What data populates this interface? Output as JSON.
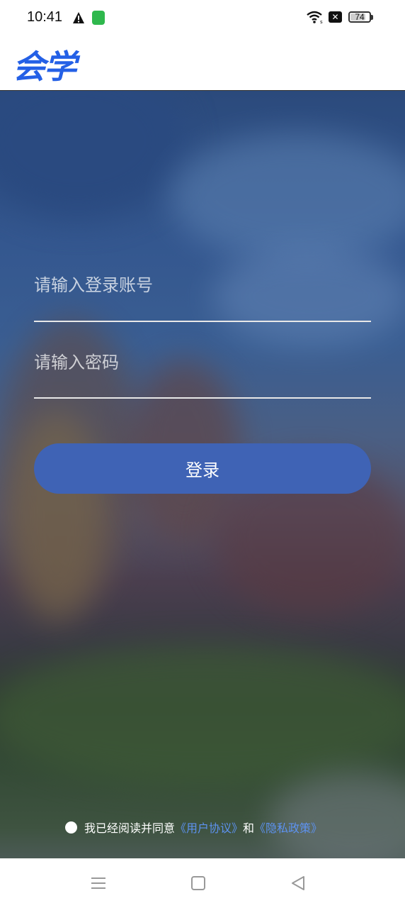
{
  "status_bar": {
    "time": "10:41",
    "battery_percent": "74",
    "icons": [
      "warning-icon",
      "app-notification-icon",
      "wifi-icon",
      "x-icon",
      "battery-icon"
    ]
  },
  "header": {
    "logo_text": "会学",
    "logo_color": "#2460e6"
  },
  "login_form": {
    "account_placeholder": "请输入登录账号",
    "password_placeholder": "请输入密码",
    "login_button": "登录",
    "button_color": "#3f63b5"
  },
  "agreement": {
    "prefix": "我已经阅读并同意",
    "user_agreement": "《用户协议》",
    "conjunction": "和",
    "privacy_policy": "《隐私政策》",
    "link_color": "#5d92f0"
  },
  "nav_bar": {
    "icons": [
      "menu-icon",
      "home-icon",
      "back-icon"
    ]
  }
}
